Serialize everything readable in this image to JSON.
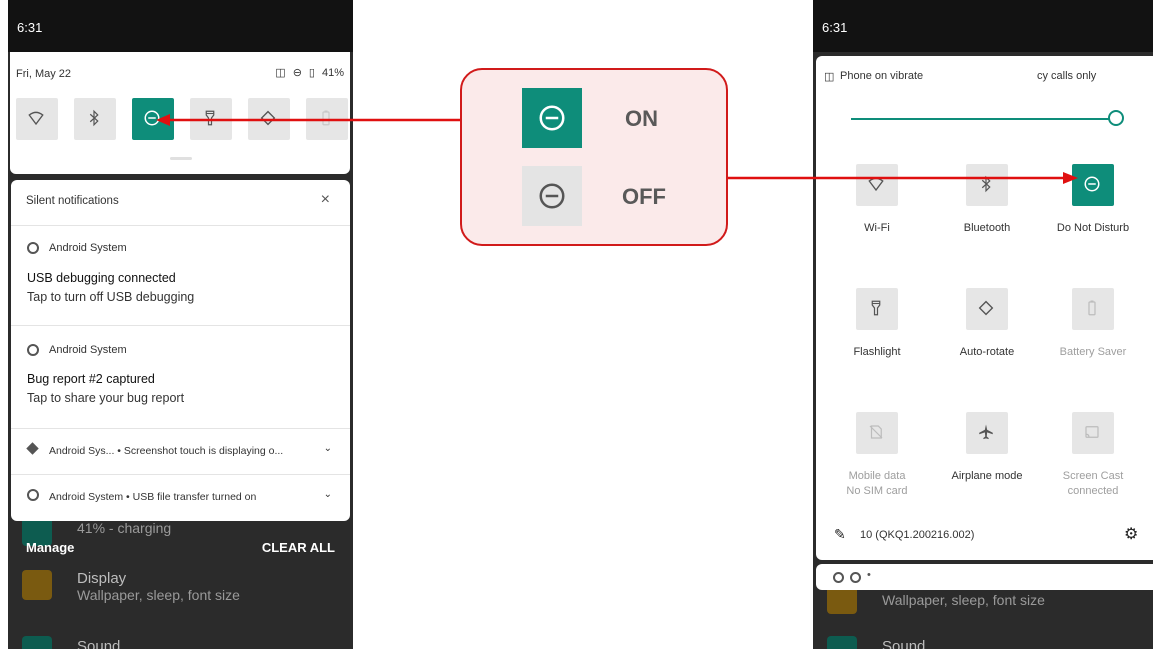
{
  "left_phone": {
    "time": "6:31",
    "date": "Fri, May 22",
    "battery": "41%",
    "quick_tiles": [
      {
        "name": "wifi-icon",
        "on": false
      },
      {
        "name": "bluetooth-icon",
        "on": false
      },
      {
        "name": "dnd-icon",
        "on": true
      },
      {
        "name": "flashlight-icon",
        "on": false
      },
      {
        "name": "auto-rotate-icon",
        "on": false
      },
      {
        "name": "battery-saver-icon",
        "on": false
      }
    ],
    "silent_header": "Silent notifications",
    "notifications": [
      {
        "app": "Android System",
        "title": "USB debugging connected",
        "text": "Tap to turn off USB debugging"
      },
      {
        "app": "Android System",
        "title": "Bug report #2 captured",
        "text": "Tap to share your bug report"
      }
    ],
    "collapsed": [
      {
        "text": "Android Sys... • Screenshot touch is displaying o..."
      },
      {
        "text": "Android System • USB file transfer turned on"
      }
    ],
    "behind_battery": "41% - charging",
    "manage": "Manage",
    "clear_all": "CLEAR ALL",
    "behind_items": [
      {
        "title": "Display",
        "subtitle": "Wallpaper, sleep, font size"
      },
      {
        "title": "Sound",
        "subtitle": ""
      }
    ]
  },
  "callout": {
    "on_label": "ON",
    "off_label": "OFF",
    "accent": "#0e8d7a",
    "border": "#d11a1a"
  },
  "right_phone": {
    "time": "6:31",
    "vibrate": "Phone on vibrate",
    "emergency": "cy calls only",
    "tiles": [
      {
        "label": "Wi-Fi",
        "sub": "",
        "icon": "wifi-icon",
        "on": false,
        "dim": false
      },
      {
        "label": "Bluetooth",
        "sub": "",
        "icon": "bluetooth-icon",
        "on": false,
        "dim": false
      },
      {
        "label": "Do Not Disturb",
        "sub": "",
        "icon": "dnd-icon",
        "on": true,
        "dim": false
      },
      {
        "label": "Flashlight",
        "sub": "",
        "icon": "flashlight-icon",
        "on": false,
        "dim": false
      },
      {
        "label": "Auto-rotate",
        "sub": "",
        "icon": "auto-rotate-icon",
        "on": false,
        "dim": false
      },
      {
        "label": "Battery Saver",
        "sub": "",
        "icon": "battery-saver-icon",
        "on": false,
        "dim": true
      },
      {
        "label": "Mobile data",
        "sub": "No SIM card",
        "icon": "mobile-data-icon",
        "on": false,
        "dim": true
      },
      {
        "label": "Airplane mode",
        "sub": "",
        "icon": "airplane-icon",
        "on": false,
        "dim": false
      },
      {
        "label": "Screen Cast",
        "sub": "connected",
        "icon": "cast-icon",
        "on": false,
        "dim": true
      }
    ],
    "build": "10 (QKQ1.200216.002)",
    "behind_subtitle": "Wallpaper, sleep, font size",
    "behind_sound": "Sound",
    "bullet": "•"
  }
}
